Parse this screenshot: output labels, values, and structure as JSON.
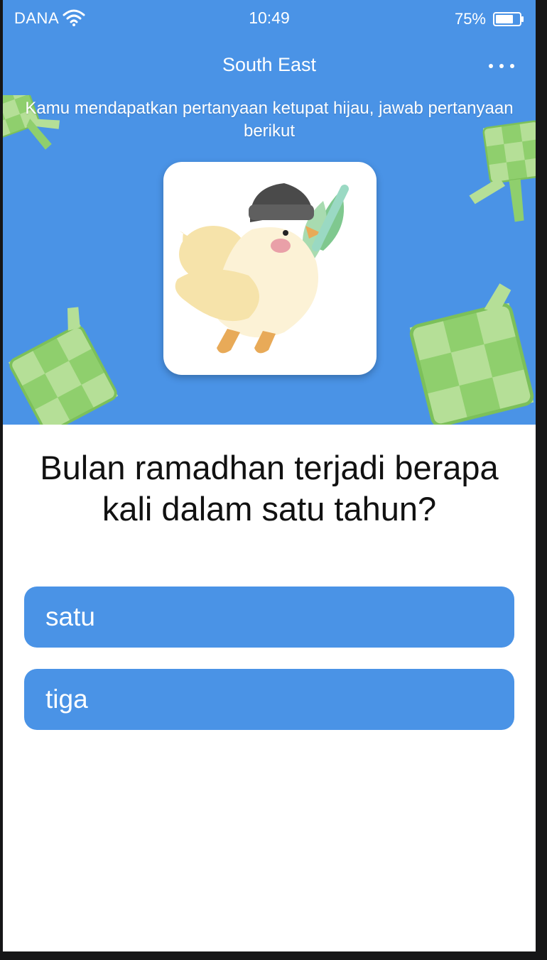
{
  "status_bar": {
    "carrier": "DANA",
    "time": "10:49",
    "battery_percent": "75%",
    "battery_level": 0.75,
    "icons": [
      "wifi-icon",
      "battery-icon"
    ]
  },
  "nav": {
    "title": "South East",
    "more_icon": "more-horizontal-icon"
  },
  "hero": {
    "message": "Kamu mendapatkan pertanyaan ketupat hijau, jawab pertanyaan berikut",
    "image": "chick-with-peci-mascot",
    "decoration": "ketupat-icon"
  },
  "quiz": {
    "question": "Bulan ramadhan terjadi berapa kali dalam satu tahun?",
    "answers": [
      "satu",
      "tiga"
    ]
  },
  "colors": {
    "primary": "#4a93e6",
    "ketupat_light": "#b5df97",
    "ketupat_dark": "#8fcf6d",
    "text": "#111111"
  }
}
